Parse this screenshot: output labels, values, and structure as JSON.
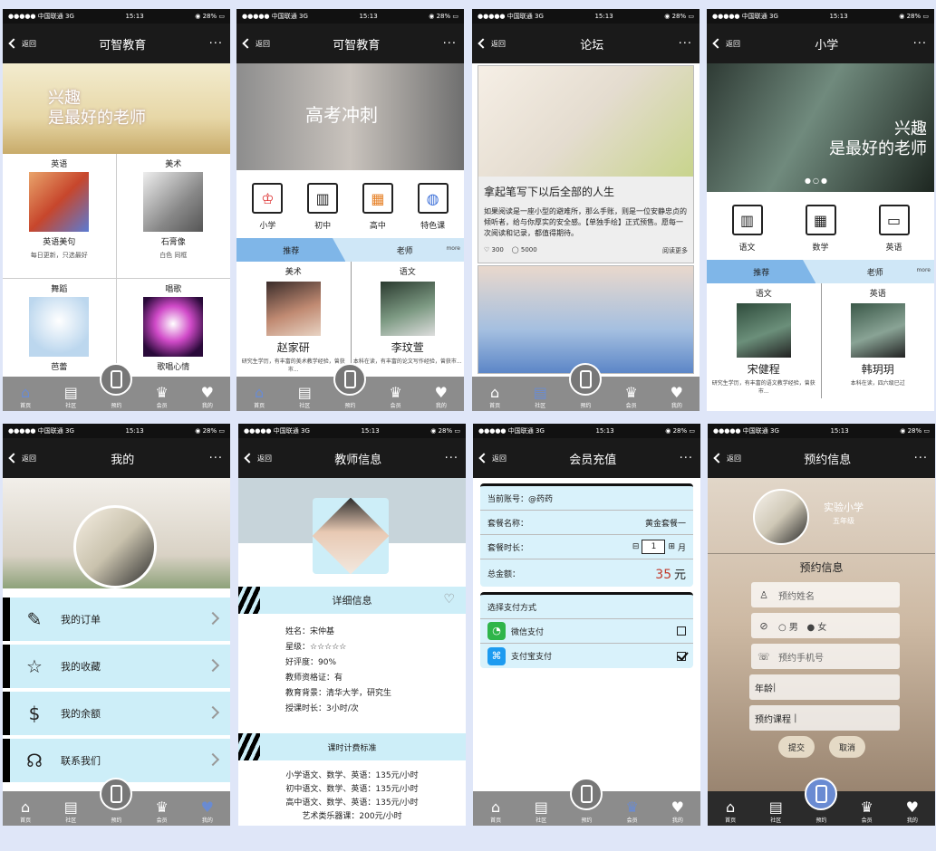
{
  "status": {
    "carrier": "●●●●● 中国联通  3G",
    "time": "15:13",
    "battery": "◉ 28% ▭"
  },
  "back_label": "返回",
  "more_label": "···",
  "tabs": [
    "首页",
    "社区",
    "预约",
    "会员",
    "我的"
  ],
  "p1": {
    "title": "可智教育",
    "banner": [
      "兴趣",
      "是最好的老师"
    ],
    "cells": [
      {
        "title": "英语",
        "sub": "英语美句",
        "desc": "每日更新，只选最好"
      },
      {
        "title": "美术",
        "sub": "石膏像",
        "desc": "白色  同框"
      },
      {
        "title": "舞蹈",
        "sub": "芭蕾",
        "desc": ""
      },
      {
        "title": "唱歌",
        "sub": "歌唱心情",
        "desc": ""
      }
    ]
  },
  "p2": {
    "title": "可智教育",
    "banner": "高考冲刺",
    "icons": [
      "小学",
      "初中",
      "高中",
      "特色课"
    ],
    "seg": [
      "推荐",
      "老师",
      "more"
    ],
    "teachers": [
      {
        "subject": "美术",
        "name": "赵家研",
        "desc": "研究生学历，有丰富的美术教学经验，曾获市..."
      },
      {
        "subject": "语文",
        "name": "李玟萱",
        "desc": "本科在读，有丰富的论文写作经验，曾获市..."
      }
    ]
  },
  "p3": {
    "title": "论坛",
    "post_title": "拿起笔写下以后全部的人生",
    "post_body": "如果阅读是一座小型的避难所，那么手账，则是一位安静忠贞的倾听者，给与你厚实的安全感。【单独手绘】正式预售。愿每一次阅读和记录，都值得期待。",
    "likes": "300",
    "comments": "5000",
    "read_more": "阅读更多"
  },
  "p4": {
    "title": "小学",
    "banner": [
      "兴趣",
      "是最好的老师"
    ],
    "icons": [
      "语文",
      "数学",
      "英语"
    ],
    "seg": [
      "推荐",
      "老师",
      "more"
    ],
    "teachers": [
      {
        "subject": "语文",
        "name": "宋健程",
        "desc": "研究生学历，有丰富的语文教学经验，曾获市..."
      },
      {
        "subject": "英语",
        "name": "韩玥玥",
        "desc": "本科在读，四六级已过"
      }
    ]
  },
  "p5": {
    "title": "我的",
    "menu": [
      "我的订单",
      "我的收藏",
      "我的余额",
      "联系我们"
    ]
  },
  "p6": {
    "title": "教师信息",
    "detail_title": "详细信息",
    "info": [
      "姓名：宋仲基",
      "星级：☆☆☆☆☆",
      "好评度：90%",
      "教师资格证：有",
      "教育背景：清华大学，研究生",
      "授课时长：3小时/次"
    ],
    "fee_title": "课时计费标准",
    "fees": [
      "小学语文、数学、英语：135元/小时",
      "初中语文、数学、英语：135元/小时",
      "高中语文、数学、英语：135元/小时",
      "艺术类乐器课：200元/小时"
    ]
  },
  "p7": {
    "title": "会员充值",
    "account": "当前账号：@药药",
    "plan_label": "套餐名称：",
    "plan_value": "黄金套餐一",
    "duration_label": "套餐时长：",
    "duration_minus": "⊟",
    "duration_value": "1",
    "duration_plus": "⊞",
    "duration_unit": "月",
    "total_label": "总金额：",
    "total_value": "35",
    "total_unit": "元",
    "pay_title": "选择支付方式",
    "wechat": "微信支付",
    "alipay": "支付宝支付"
  },
  "p8": {
    "title": "预约信息",
    "school": "实验小学",
    "grade": "五年级",
    "form_title": "预约信息",
    "name_ph": "预约姓名",
    "male": "男",
    "female": "女",
    "phone_ph": "预约手机号",
    "age_label": "年龄",
    "course_label": "预约课程",
    "submit": "提交",
    "cancel": "取消"
  },
  "colors": {
    "accent": "#6a8bd2",
    "seg": "#7fb6e8",
    "panel": "#cdeef8",
    "price": "#c0392b"
  }
}
